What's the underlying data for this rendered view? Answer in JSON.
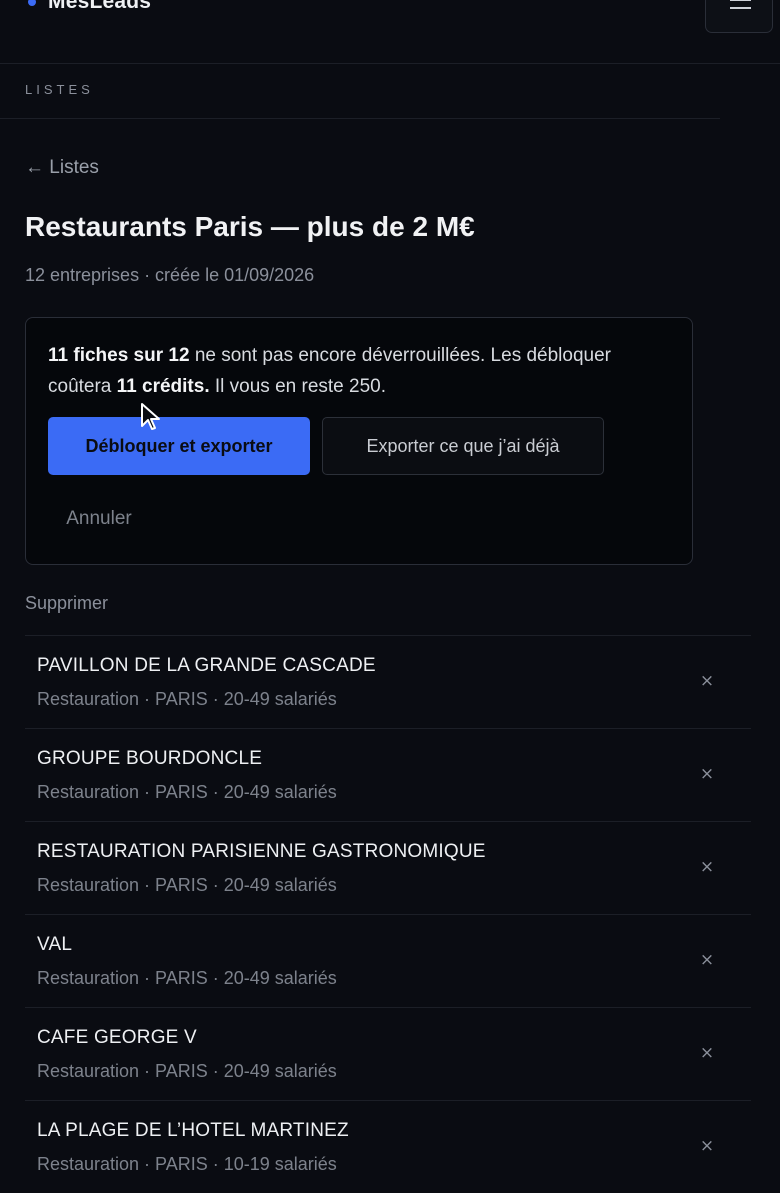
{
  "header": {
    "brand": "MesLeads",
    "menu_icon": "hamburger-menu-icon"
  },
  "section": {
    "label": "LISTES"
  },
  "back_link": "← Listes",
  "list": {
    "title": "Restaurants Paris — plus de 2 M€",
    "subtitle": "12 entreprises · créée le 01/09/2026"
  },
  "notice": {
    "locked_count": "11 fiches sur 12",
    "text_1": " ne sont pas encore déverrouillées. Les débloquer coûtera ",
    "credits": "11 crédits.",
    "text_2": " Il vous en reste 250.",
    "unlock_export_label": "Débloquer et exporter",
    "export_existing_label": "Exporter ce que j’ai déjà",
    "cancel_label": "Annuler"
  },
  "delete_label": "Supprimer",
  "companies": [
    {
      "name": "PAVILLON DE LA GRANDE CASCADE",
      "meta": "Restauration · PARIS · 20-49 salariés",
      "remove": "×"
    },
    {
      "name": "GROUPE BOURDONCLE",
      "meta": "Restauration · PARIS · 20-49 salariés",
      "remove": "×"
    },
    {
      "name": "RESTAURATION PARISIENNE GASTRONOMIQUE",
      "meta": "Restauration · PARIS · 20-49 salariés",
      "remove": "×"
    },
    {
      "name": "VAL",
      "meta": "Restauration · PARIS · 20-49 salariés",
      "remove": "×"
    },
    {
      "name": "CAFE GEORGE V",
      "meta": "Restauration · PARIS · 20-49 salariés",
      "remove": "×"
    },
    {
      "name": "LA PLAGE DE L’HOTEL MARTINEZ",
      "meta": "Restauration · PARIS · 10-19 salariés",
      "remove": "×"
    }
  ],
  "colors": {
    "background": "#0a0c12",
    "accent": "#3b6bf5",
    "muted_text": "#7d828c"
  }
}
